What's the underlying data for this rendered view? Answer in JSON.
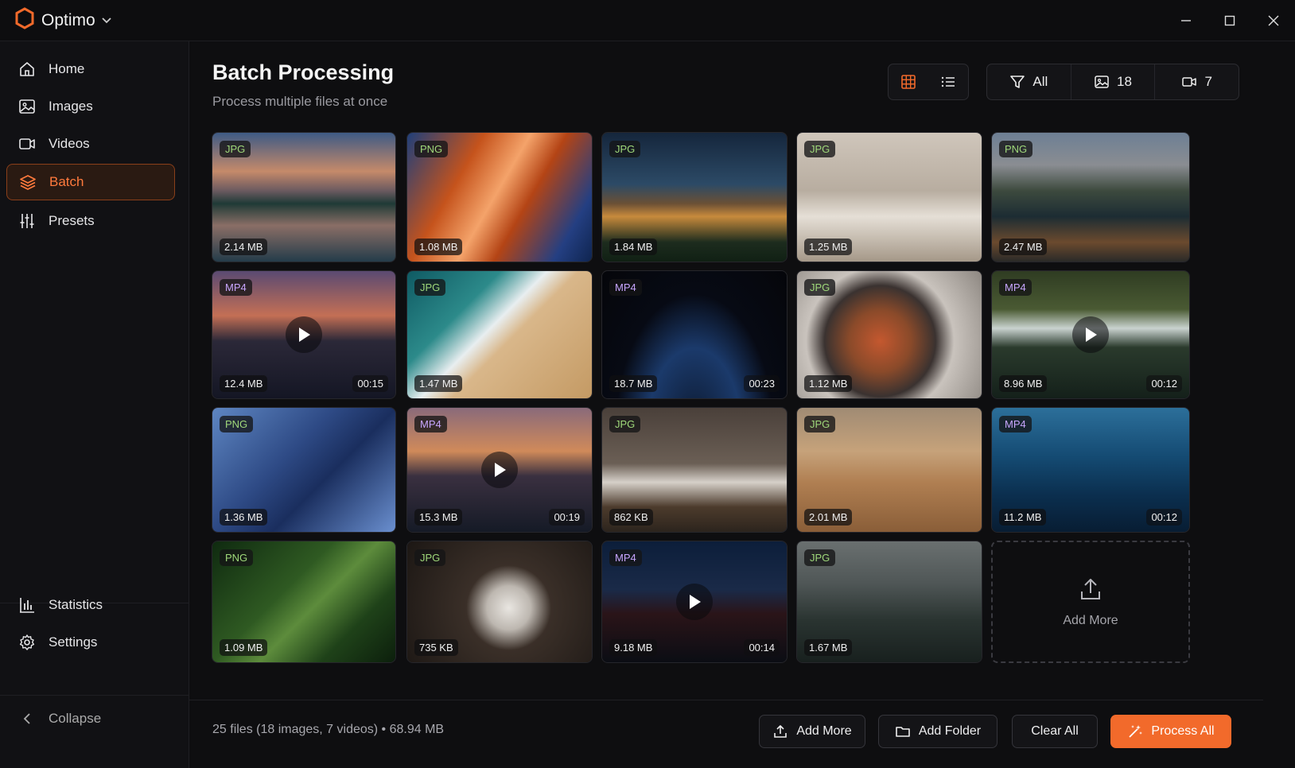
{
  "app": {
    "name": "Optimo"
  },
  "nav": {
    "items": [
      {
        "label": "Home",
        "icon": "home-icon"
      },
      {
        "label": "Images",
        "icon": "image-icon"
      },
      {
        "label": "Videos",
        "icon": "video-icon"
      },
      {
        "label": "Batch",
        "icon": "layers-icon",
        "active": true
      },
      {
        "label": "Presets",
        "icon": "sliders-icon"
      }
    ],
    "bottom": [
      {
        "label": "Statistics",
        "icon": "bar-chart-icon"
      },
      {
        "label": "Settings",
        "icon": "gear-icon"
      }
    ],
    "collapse_label": "Collapse"
  },
  "header": {
    "title": "Batch Processing",
    "subtitle": "Process multiple files at once"
  },
  "filters": {
    "all_label": "All",
    "images_count": "18",
    "videos_count": "7"
  },
  "files": [
    {
      "format": "JPG",
      "size": "2.14 MB",
      "scene": "mountain-lake"
    },
    {
      "format": "PNG",
      "size": "1.08 MB",
      "scene": "canyon-abstract"
    },
    {
      "format": "JPG",
      "size": "1.84 MB",
      "scene": "modern-house"
    },
    {
      "format": "JPG",
      "size": "1.25 MB",
      "scene": "living-room"
    },
    {
      "format": "PNG",
      "size": "2.47 MB",
      "scene": "lake-dock"
    },
    {
      "format": "MP4",
      "size": "12.4 MB",
      "duration": "00:15",
      "scene": "city-sunset"
    },
    {
      "format": "JPG",
      "size": "1.47 MB",
      "scene": "beach-aerial"
    },
    {
      "format": "MP4",
      "size": "18.7 MB",
      "duration": "00:23",
      "scene": "earth-night"
    },
    {
      "format": "JPG",
      "size": "1.12 MB",
      "scene": "fruit-bowl"
    },
    {
      "format": "MP4",
      "size": "8.96 MB",
      "duration": "00:12",
      "scene": "waterfall"
    },
    {
      "format": "PNG",
      "size": "1.36 MB",
      "scene": "glass-building"
    },
    {
      "format": "MP4",
      "size": "15.3 MB",
      "duration": "00:19",
      "scene": "golden-gate"
    },
    {
      "format": "JPG",
      "size": "862 KB",
      "scene": "vase-flowers"
    },
    {
      "format": "JPG",
      "size": "2.01 MB",
      "scene": "desert-dunes"
    },
    {
      "format": "MP4",
      "size": "11.2 MB",
      "duration": "00:12",
      "scene": "sea-turtle"
    },
    {
      "format": "PNG",
      "size": "1.09 MB",
      "scene": "green-leaf"
    },
    {
      "format": "JPG",
      "size": "735 KB",
      "scene": "coffee-cup"
    },
    {
      "format": "MP4",
      "size": "9.18 MB",
      "duration": "00:14",
      "scene": "night-street"
    },
    {
      "format": "JPG",
      "size": "1.67 MB",
      "scene": "pine-forest"
    }
  ],
  "add_card_label": "Add More",
  "footer": {
    "summary": "25 files (18 images, 7 videos)  •  68.94 MB",
    "add_more_label": "Add More",
    "add_folder_label": "Add Folder",
    "clear_all_label": "Clear All",
    "process_all_label": "Process All"
  },
  "colors": {
    "accent": "#f26a2b",
    "background": "#0e0e10",
    "sidebar": "#111114"
  }
}
